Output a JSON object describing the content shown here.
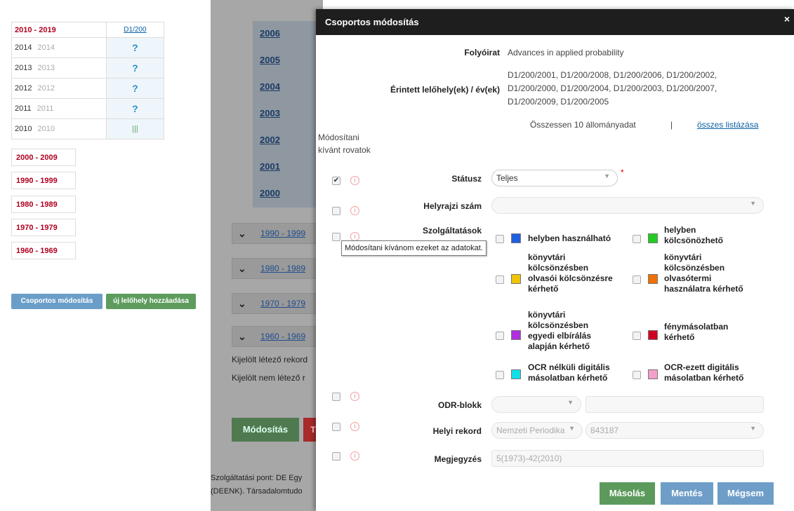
{
  "left": {
    "decade_current": "2010 - 2019",
    "d1_link": "D1/200",
    "years": [
      {
        "year": "2014",
        "year2": "2014",
        "status": "?"
      },
      {
        "year": "2013",
        "year2": "2013",
        "status": "?"
      },
      {
        "year": "2012",
        "year2": "2012",
        "status": "?"
      },
      {
        "year": "2011",
        "year2": "2011",
        "status": "?"
      },
      {
        "year": "2010",
        "year2": "2010",
        "status": "|||"
      }
    ],
    "decades": [
      "2000 - 2009",
      "1990 - 1999",
      "1980 - 1989",
      "1970 - 1979",
      "1960 - 1969"
    ],
    "group_button": "Csoportos módosítás",
    "new_location_button": "új lelőhely hozzáadása"
  },
  "middle": {
    "years": [
      "2006",
      "2005",
      "2004",
      "2003",
      "2002",
      "2001",
      "2000"
    ],
    "decades": [
      "1990 - 1999",
      "1980 - 1989",
      "1970 - 1979",
      "1960 - 1969"
    ],
    "selected_existing": "Kijelölt létező rekord",
    "selected_nonexisting": "Kijelölt nem létező r",
    "modify_button": "Módosítás",
    "red_button": "T",
    "footer1": "Szolgáltatási pont: DE Egy",
    "footer2": "(DEENK). Társadalomtudo"
  },
  "modal": {
    "title": "Csoportos módosítás",
    "close": "×",
    "journal_label": "Folyóirat",
    "journal_value": "Advances in applied probability",
    "locations_label": "Érintett lelőhely(ek) / év(ek)",
    "locations_line1": "D1/200/2001, D1/200/2008, D1/200/2006, D1/200/2002,",
    "locations_line2": "D1/200/2000, D1/200/2004, D1/200/2003, D1/200/2007,",
    "locations_line3": "D1/200/2009, D1/200/2005",
    "total_text": "Összessen 10 állományadat",
    "separator": "|",
    "list_all": "összes listázása",
    "modify_fields_line1": "Módosítani",
    "modify_fields_line2": "kívánt rovatok",
    "status_label": "Státusz",
    "status_value": "Teljes",
    "required_mark": "*",
    "topo_label": "Helyrajzi szám",
    "services_label": "Szolgáltatások",
    "tooltip": "Módosítani kívánom ezeket az adatokat.",
    "services": [
      {
        "line1": "helyben használható",
        "line2": "",
        "line3": "",
        "line4": "",
        "color": "#1f5fe0"
      },
      {
        "line1": "helyben",
        "line2": "kölcsönözhető",
        "line3": "",
        "line4": "",
        "color": "#22cc22"
      },
      {
        "line1": "könyvtári",
        "line2": "kölcsönzésben",
        "line3": "olvasói kölcsönzésre",
        "line4": "kérhető",
        "color": "#f0c400"
      },
      {
        "line1": "könyvtári",
        "line2": "kölcsönzésben",
        "line3": "olvasótermi",
        "line4": "használatra kérhető",
        "color": "#f07000"
      },
      {
        "line1": "könyvtári",
        "line2": "kölcsönzésben",
        "line3": "egyedi elbírálás",
        "line4": "alapján kérhető",
        "color": "#b030e0"
      },
      {
        "line1": "fénymásolatban",
        "line2": "kérhető",
        "line3": "",
        "line4": "",
        "color": "#d00020"
      },
      {
        "line1": "OCR nélküli digitális",
        "line2": "másolatban kérhető",
        "line3": "",
        "line4": "",
        "color": "#10e0e8"
      },
      {
        "line1": "OCR-ezett digitális",
        "line2": "másolatban kérhető",
        "line3": "",
        "line4": "",
        "color": "#f4a0c8"
      }
    ],
    "odr_label": "ODR-blokk",
    "local_label": "Helyi rekord",
    "local_value1": "Nemzeti Periodika",
    "local_value2": "843187",
    "note_label": "Megjegyzés",
    "note_value": "5(1973)-42(2010)",
    "copy_button": "Másolás",
    "save_button": "Mentés",
    "cancel_button": "Mégsem",
    "info_glyph": "i",
    "check_glyph": "✔",
    "caret": "▼"
  }
}
